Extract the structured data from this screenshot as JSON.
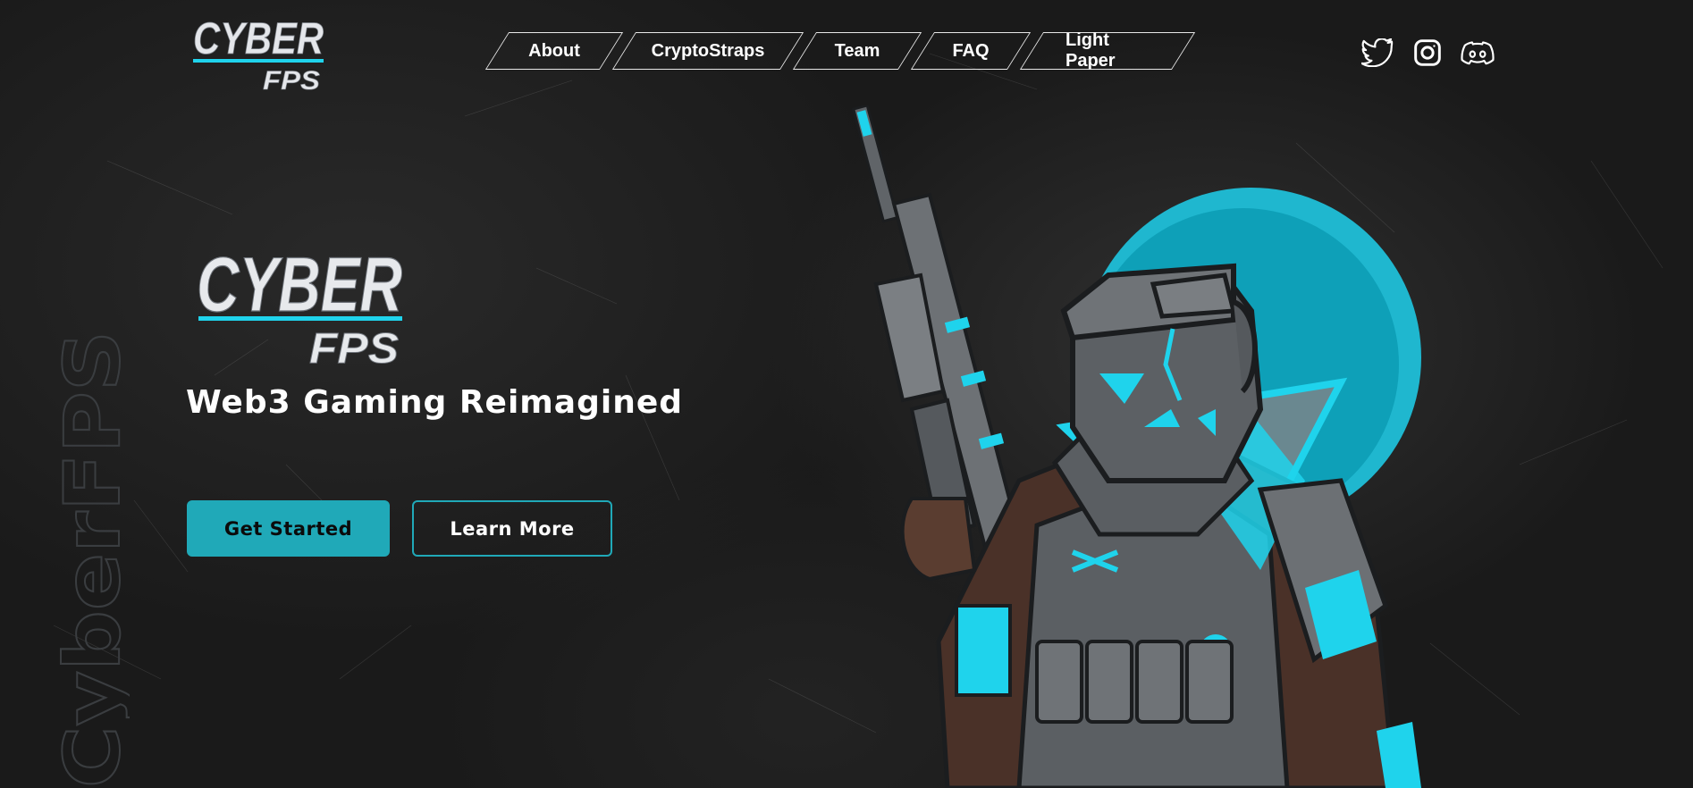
{
  "brand": {
    "logo_top": "CYBER",
    "logo_bottom": "FPS",
    "vertical_watermark": "CyberFPS"
  },
  "nav": {
    "items": [
      {
        "label": "About"
      },
      {
        "label": "CryptoStraps"
      },
      {
        "label": "Team"
      },
      {
        "label": "FAQ"
      },
      {
        "label": "Light Paper"
      }
    ]
  },
  "socials": [
    {
      "icon": "twitter-icon"
    },
    {
      "icon": "instagram-icon"
    },
    {
      "icon": "discord-icon"
    }
  ],
  "hero": {
    "tagline": "Web3 Gaming Reimagined",
    "primary_button": "Get Started",
    "secondary_button": "Learn More"
  },
  "colors": {
    "accent": "#20a9b8",
    "accent_bright": "#1fd3ec",
    "background": "#1a1a1a"
  }
}
